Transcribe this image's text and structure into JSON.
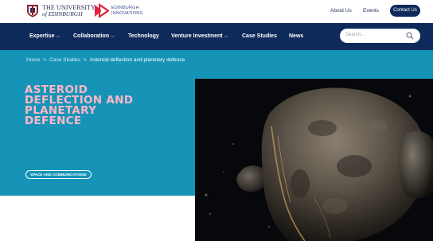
{
  "header": {
    "university_line1": "THE UNIVERSITY",
    "university_line2": "of EDINBURGH",
    "innovations_line1": "EDINBURGH",
    "innovations_line2": "INNOVATIONS",
    "links": [
      "About Us",
      "Events"
    ],
    "contact_label": "Contact Us",
    "colors": {
      "navy": "#0e2a5a",
      "teal": "#1694b8",
      "pink": "#ffb7c5"
    }
  },
  "nav": {
    "items": [
      {
        "label": "Expertise",
        "chevron": "⌵"
      },
      {
        "label": "Collaboration",
        "chevron": "⌵"
      },
      {
        "label": "Technology",
        "chevron": ""
      },
      {
        "label": "Venture Investment",
        "chevron": "⌵"
      },
      {
        "label": "Case Studies",
        "chevron": ""
      },
      {
        "label": "News",
        "chevron": ""
      }
    ],
    "search_placeholder": "Search..."
  },
  "breadcrumb": {
    "home": "Home",
    "case_studies": "Case Studies",
    "current": "Asteroid deflection and planetary defence",
    "separator": ">"
  },
  "hero": {
    "title": "Asteroid deflection and planetary defence",
    "tag": "SPACE AND COMMUNICATIONS"
  }
}
